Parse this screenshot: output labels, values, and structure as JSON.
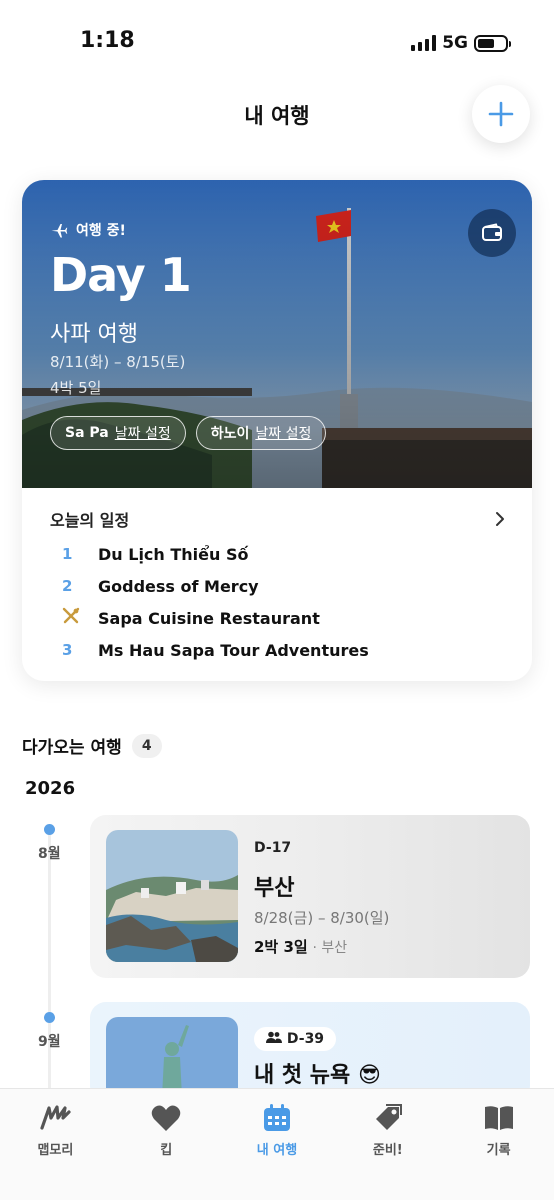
{
  "status_bar": {
    "time": "1:18",
    "network": "5G"
  },
  "header": {
    "title": "내 여행",
    "add_button": "plus-icon"
  },
  "current_trip": {
    "status": "여행 중!",
    "day": "Day 1",
    "name": "사파 여행",
    "dates": "8/11(화) – 8/15(토)",
    "nights": "4박 5일",
    "chips": [
      {
        "city": "Sa Pa",
        "action": "날짜 설정"
      },
      {
        "city": "하노이",
        "action": "날짜 설정"
      }
    ],
    "today_title": "오늘의 일정",
    "schedule": [
      {
        "marker": "1",
        "name": "Du Lịch Thiểu Số"
      },
      {
        "marker": "2",
        "name": "Goddess of Mercy"
      },
      {
        "marker": "restaurant-icon",
        "name": "Sapa Cuisine Restaurant"
      },
      {
        "marker": "3",
        "name": "Ms Hau Sapa Tour Adventures"
      }
    ]
  },
  "upcoming": {
    "title": "다가오는 여행",
    "count": "4",
    "year": "2026",
    "trips": [
      {
        "month": "8월",
        "dday": "D-17",
        "name": "부산",
        "dates": "8/28(금) – 8/30(일)",
        "nights": "2박 3일",
        "place": "· 부산"
      },
      {
        "month": "9월",
        "dday": "D-39",
        "name": "내 첫 뉴욕 😎",
        "shared": true
      }
    ]
  },
  "tabs": [
    {
      "label": "맵모리",
      "icon": "map-scribble-icon"
    },
    {
      "label": "킵",
      "icon": "heart-icon"
    },
    {
      "label": "내 여행",
      "icon": "calendar-icon",
      "active": true
    },
    {
      "label": "준비!",
      "icon": "tag-icon"
    },
    {
      "label": "기록",
      "icon": "book-icon"
    }
  ],
  "colors": {
    "accent": "#4a9ae6",
    "timeline_dot": "#5aa0e6"
  }
}
